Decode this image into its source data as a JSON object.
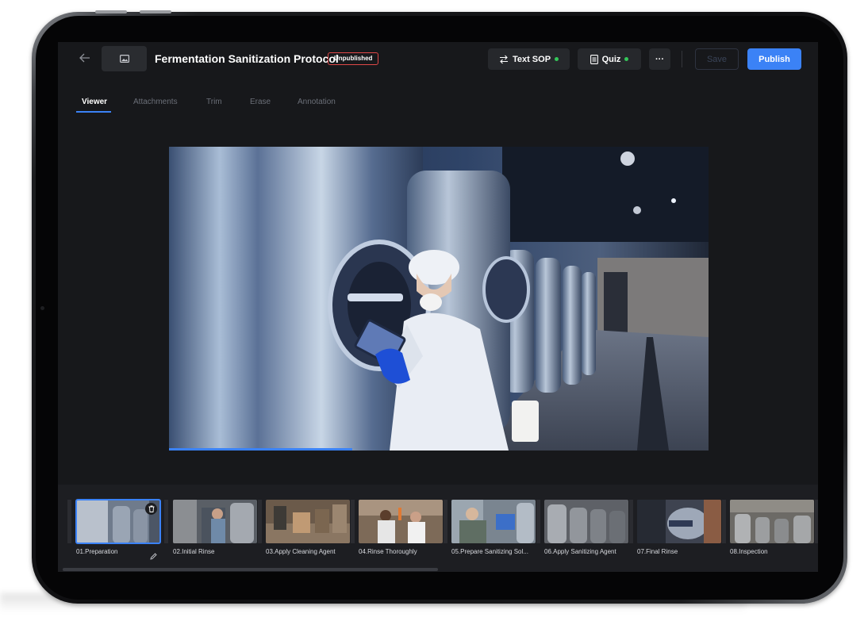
{
  "header": {
    "title": "Fermentation Sanitization Protocol",
    "status_badge": "Unpublished",
    "text_sop_label": "Text SOP",
    "quiz_label": "Quiz",
    "more_label": "···",
    "save_label": "Save",
    "publish_label": "Publish"
  },
  "tabs": [
    {
      "label": "Viewer",
      "active": true
    },
    {
      "label": "Attachments",
      "active": false
    },
    {
      "label": "Trim",
      "active": false
    },
    {
      "label": "Erase",
      "active": false
    },
    {
      "label": "Annotation",
      "active": false
    }
  ],
  "viewer": {
    "image": "brewery-worker-with-tablet",
    "progress": 0.34
  },
  "steps": [
    {
      "label": "01.Preparation",
      "active": true
    },
    {
      "label": "02.Initial Rinse",
      "active": false
    },
    {
      "label": "03.Apply Cleaning Agent",
      "active": false
    },
    {
      "label": "04.Rinse Thoroughly",
      "active": false
    },
    {
      "label": "05.Prepare Sanitizing Sol...",
      "active": false
    },
    {
      "label": "06.Apply Sanitizing Agent",
      "active": false
    },
    {
      "label": "07.Final Rinse",
      "active": false
    },
    {
      "label": "08.Inspection",
      "active": false
    }
  ],
  "colors": {
    "accent": "#3b82f6",
    "status_ok": "#34c759",
    "badge_border": "#e04848"
  }
}
